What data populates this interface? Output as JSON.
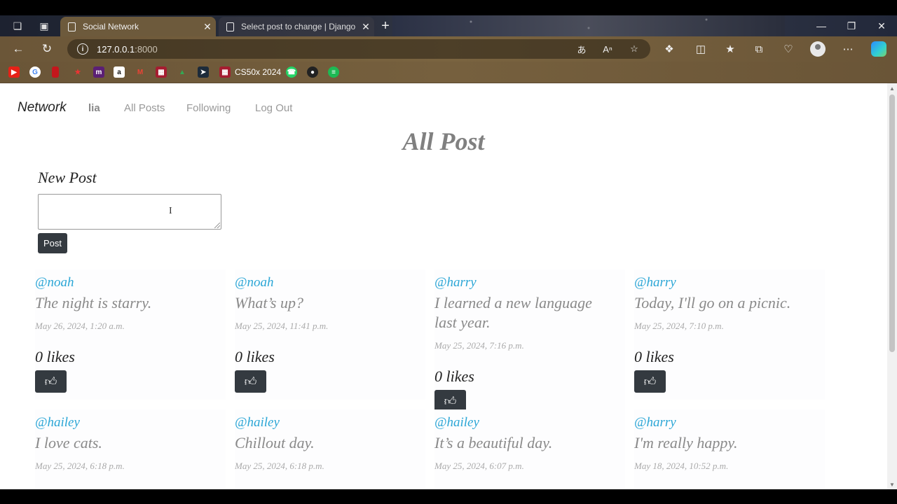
{
  "browser": {
    "tabs": [
      {
        "label": "Social Network",
        "active": true
      },
      {
        "label": "Select post to change | Django s",
        "active": false
      }
    ],
    "url_host": "127.0.0.1",
    "url_port": ":8000",
    "bookmark_label": "CS50x 2024"
  },
  "nav": {
    "brand": "Network",
    "user": "lia",
    "all_posts": "All Posts",
    "following": "Following",
    "logout": "Log Out"
  },
  "page_title": "All Post",
  "new_post": {
    "label": "New Post",
    "value": "",
    "button": "Post"
  },
  "posts": [
    {
      "author": "@noah",
      "content": "The night is starry.",
      "date": "May 26, 2024, 1:20 a.m.",
      "likes": "0 likes"
    },
    {
      "author": "@noah",
      "content": "What’s up?",
      "date": "May 25, 2024, 11:41 p.m.",
      "likes": "0 likes"
    },
    {
      "author": "@harry",
      "content": "I learned a new language last year.",
      "date": "May 25, 2024, 7:16 p.m.",
      "likes": "0 likes"
    },
    {
      "author": "@harry",
      "content": "Today, I'll go on a picnic.",
      "date": "May 25, 2024, 7:10 p.m.",
      "likes": "0 likes"
    },
    {
      "author": "@hailey",
      "content": "I love cats.",
      "date": "May 25, 2024, 6:18 p.m."
    },
    {
      "author": "@hailey",
      "content": "Chillout day.",
      "date": "May 25, 2024, 6:18 p.m."
    },
    {
      "author": "@hailey",
      "content": "It’s a beautiful day.",
      "date": "May 25, 2024, 6:07 p.m."
    },
    {
      "author": "@harry",
      "content": "I'm really happy.",
      "date": "May 18, 2024, 10:52 p.m."
    }
  ]
}
